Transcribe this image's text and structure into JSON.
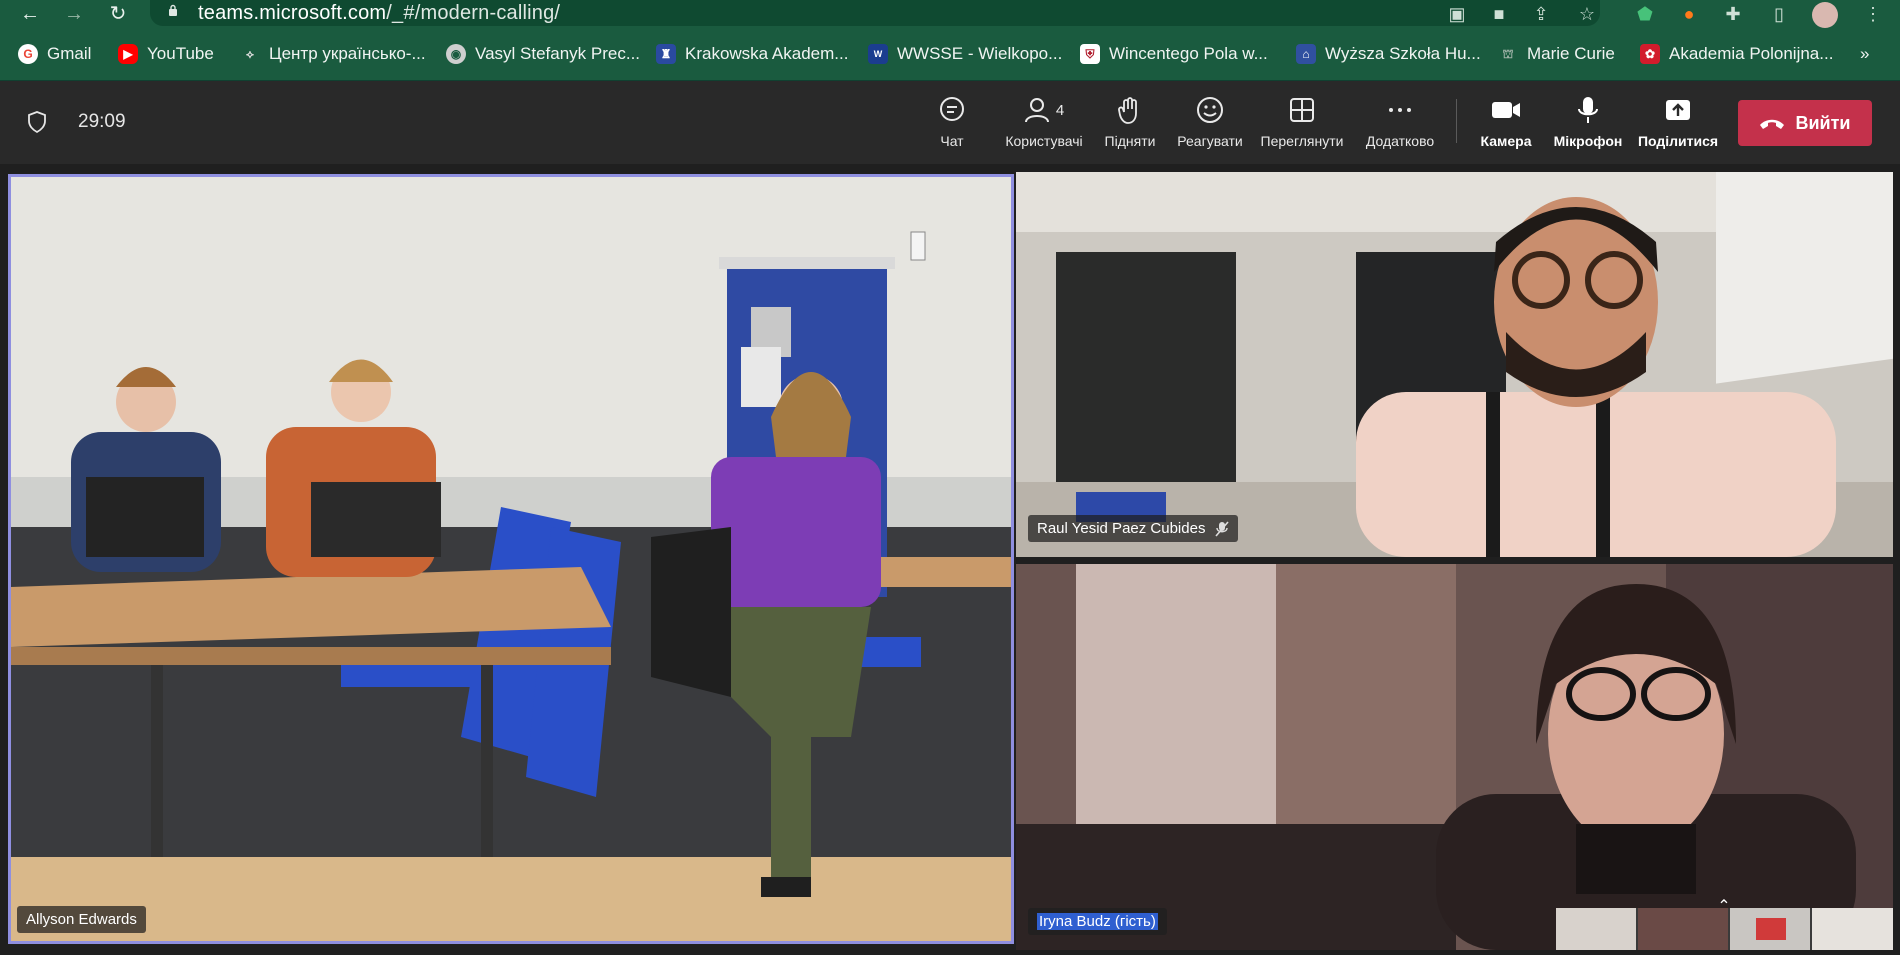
{
  "browser": {
    "url_host": "teams.microsoft.com",
    "url_path": "/_#/modern-calling/",
    "bookmarks": [
      {
        "label": "Gmail",
        "icon": "gmail-icon",
        "color": "#ea4335"
      },
      {
        "label": "YouTube",
        "icon": "youtube-icon",
        "color": "#ff0000"
      },
      {
        "label": "Центр українсько-...",
        "icon": "bookmark-icon",
        "color": "#e0e0e0"
      },
      {
        "label": "Vasyl Stefanyk Prec...",
        "icon": "university-icon",
        "color": "#cfcfcf"
      },
      {
        "label": "Krakowska Akadem...",
        "icon": "university-icon",
        "color": "#2a4aa0"
      },
      {
        "label": "WWSSE - Wielkopo...",
        "icon": "university-icon",
        "color": "#1b3d8f"
      },
      {
        "label": "Wincentego Pola w...",
        "icon": "university-icon",
        "color": "#b22030"
      },
      {
        "label": "Wyższa Szkoła Hu...",
        "icon": "university-icon",
        "color": "#3050a0"
      },
      {
        "label": "Marie Curie",
        "icon": "university-icon",
        "color": "#7a8a80"
      },
      {
        "label": "Akademia Polonijna...",
        "icon": "university-icon",
        "color": "#d21c2c"
      }
    ],
    "more_bookmarks": "»"
  },
  "call": {
    "timer": "29:09",
    "controls": {
      "chat": "Чат",
      "people": "Користувачі",
      "people_count": "4",
      "raise": "Підняти",
      "react": "Реагувати",
      "view": "Переглянути",
      "more": "Додатково",
      "camera": "Камера",
      "mic": "Мікрофон",
      "share": "Поділитися",
      "leave": "Вийти"
    },
    "leave_color": "#c4314b"
  },
  "participants": {
    "main": "Allyson Edwards",
    "top_right": "Raul Yesid Paez Cubides",
    "bottom_right": "Iryna Budz (гість)"
  }
}
